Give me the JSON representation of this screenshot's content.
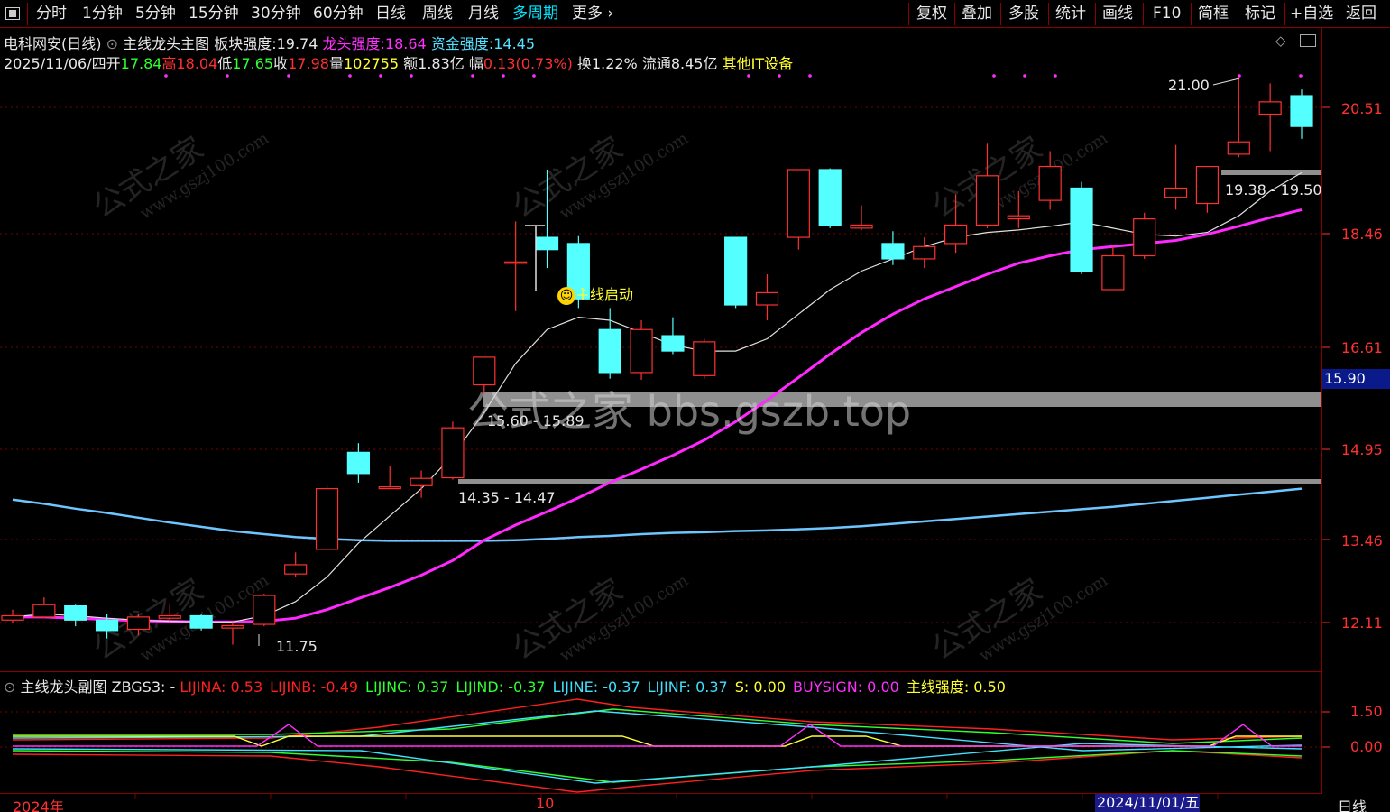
{
  "toolbar": {
    "left": [
      "分时",
      "1分钟",
      "5分钟",
      "15分钟",
      "30分钟",
      "60分钟",
      "日线",
      "周线",
      "月线",
      "多周期",
      "更多"
    ],
    "right": [
      "复权",
      "叠加",
      "多股",
      "统计",
      "画线",
      "F10",
      "简框",
      "标记",
      "+自选",
      "返回"
    ]
  },
  "info": {
    "stock": "电科网安(日线)",
    "indicator": "主线龙头主图",
    "bk_label": "板块强度:",
    "bk_value": "19.74",
    "lt_label": "龙头强度:",
    "lt_value": "18.64",
    "zj_label": "资金强度:",
    "zj_value": "14.45",
    "date": "2025/11/06/四",
    "open_label": "开",
    "open": "17.84",
    "high_label": "高",
    "high": "18.04",
    "low_label": "低",
    "low": "17.65",
    "close_label": "收",
    "close": "17.98",
    "vol_label": "量",
    "vol": "102755",
    "amt_label": "额",
    "amt": "1.83亿",
    "chg_label": "幅",
    "chg": "0.13(0.73%)",
    "turn": "换1.22%",
    "float": "流通8.45亿",
    "sector": "其他IT设备"
  },
  "price_axis": [
    "20.51",
    "18.46",
    "16.61",
    "14.95",
    "13.46",
    "12.11"
  ],
  "current_price_tag": "15.90",
  "annotations": {
    "high_mark": "21.00",
    "low_mark": "11.75",
    "zone1": "15.60 - 15.89",
    "zone2": "14.35 - 14.47",
    "zone3": "19.38 - 19.50",
    "signal": "主线启动"
  },
  "big_watermark": "公式之家 bbs.gszb.top",
  "watermark_text": "公式之家",
  "watermark_url": "www.gszj100.com",
  "sub_info": {
    "name": "主线龙头副图",
    "zbgs": "ZBGS3: -",
    "items": [
      {
        "label": "LIJINA:",
        "value": "0.53",
        "color": "#ff2020"
      },
      {
        "label": "LIJINB:",
        "value": "-0.49",
        "color": "#ff2020"
      },
      {
        "label": "LIJINC:",
        "value": "0.37",
        "color": "#30ff30"
      },
      {
        "label": "LIJIND:",
        "value": "-0.37",
        "color": "#30ff30"
      },
      {
        "label": "LIJINE:",
        "value": "-0.37",
        "color": "#40e0ff"
      },
      {
        "label": "LIJINF:",
        "value": "0.37",
        "color": "#40e0ff"
      },
      {
        "label": "S:",
        "value": "0.00",
        "color": "#ffff30"
      },
      {
        "label": "BUYSIGN:",
        "value": "0.00",
        "color": "#ff30ff"
      },
      {
        "label": "主线强度:",
        "value": "0.50",
        "color": "#ffff30"
      }
    ]
  },
  "sub_axis": [
    "1.50",
    "0.00"
  ],
  "dates": {
    "start": "2024年",
    "mid": "10",
    "hl": "2024/11/01/五",
    "period": "日线"
  },
  "colors": {
    "up": "#ff3030",
    "down": "#54ffff",
    "ma_white": "#e0e0e0",
    "ma_magenta": "#ff28ff",
    "ma_blue": "#6ec6ff"
  },
  "candles": [
    {
      "o": 12.15,
      "c": 12.22,
      "h": 12.32,
      "l": 12.1
    },
    {
      "o": 12.2,
      "c": 12.4,
      "h": 12.52,
      "l": 12.18
    },
    {
      "o": 12.38,
      "c": 12.15,
      "h": 12.4,
      "l": 12.05
    },
    {
      "o": 12.15,
      "c": 11.98,
      "h": 12.25,
      "l": 11.85
    },
    {
      "o": 12.0,
      "c": 12.2,
      "h": 12.25,
      "l": 11.9
    },
    {
      "o": 12.18,
      "c": 12.22,
      "h": 12.4,
      "l": 12.1
    },
    {
      "o": 12.22,
      "c": 12.02,
      "h": 12.25,
      "l": 11.98
    },
    {
      "o": 12.02,
      "c": 12.06,
      "h": 12.12,
      "l": 11.75
    },
    {
      "o": 12.08,
      "c": 12.55,
      "h": 12.58,
      "l": 12.05
    },
    {
      "o": 12.9,
      "c": 13.05,
      "h": 13.25,
      "l": 12.85
    },
    {
      "o": 13.3,
      "c": 14.3,
      "h": 14.35,
      "l": 13.3
    },
    {
      "o": 14.9,
      "c": 14.55,
      "h": 15.05,
      "l": 14.4
    },
    {
      "o": 14.3,
      "c": 14.33,
      "h": 14.68,
      "l": 14.3
    },
    {
      "o": 14.35,
      "c": 14.47,
      "h": 14.6,
      "l": 14.15
    },
    {
      "o": 14.48,
      "c": 15.3,
      "h": 15.4,
      "l": 14.45
    },
    {
      "o": 16.0,
      "c": 16.45,
      "h": 16.45,
      "l": 15.85
    },
    {
      "o": 18.0,
      "c": 18.0,
      "h": 18.66,
      "l": 17.2
    },
    {
      "o": 18.4,
      "c": 18.2,
      "h": 19.5,
      "l": 17.9
    },
    {
      "o": 18.3,
      "c": 17.4,
      "h": 18.42,
      "l": 17.25
    },
    {
      "o": 16.9,
      "c": 16.2,
      "h": 17.25,
      "l": 16.1
    },
    {
      "o": 16.2,
      "c": 16.9,
      "h": 17.05,
      "l": 16.08
    },
    {
      "o": 16.8,
      "c": 16.55,
      "h": 17.1,
      "l": 16.5
    },
    {
      "o": 16.15,
      "c": 16.7,
      "h": 16.75,
      "l": 16.1
    },
    {
      "o": 18.4,
      "c": 17.3,
      "h": 18.4,
      "l": 17.25
    },
    {
      "o": 17.3,
      "c": 17.5,
      "h": 17.8,
      "l": 17.05
    },
    {
      "o": 18.4,
      "c": 19.5,
      "h": 19.5,
      "l": 18.2
    },
    {
      "o": 19.5,
      "c": 18.6,
      "h": 19.52,
      "l": 18.55
    },
    {
      "o": 18.55,
      "c": 18.6,
      "h": 18.92,
      "l": 18.52
    },
    {
      "o": 18.3,
      "c": 18.05,
      "h": 18.5,
      "l": 17.95
    },
    {
      "o": 18.05,
      "c": 18.25,
      "h": 18.4,
      "l": 17.9
    },
    {
      "o": 18.3,
      "c": 18.6,
      "h": 19.1,
      "l": 18.15
    },
    {
      "o": 18.6,
      "c": 19.4,
      "h": 19.92,
      "l": 18.55
    },
    {
      "o": 18.7,
      "c": 18.75,
      "h": 19.15,
      "l": 18.55
    },
    {
      "o": 19.0,
      "c": 19.55,
      "h": 19.8,
      "l": 18.85
    },
    {
      "o": 19.2,
      "c": 17.85,
      "h": 19.3,
      "l": 17.8
    },
    {
      "o": 17.55,
      "c": 18.1,
      "h": 18.25,
      "l": 17.55
    },
    {
      "o": 18.1,
      "c": 18.7,
      "h": 18.8,
      "l": 18.05
    },
    {
      "o": 19.05,
      "c": 19.2,
      "h": 19.9,
      "l": 18.85
    },
    {
      "o": 18.95,
      "c": 19.55,
      "h": 19.55,
      "l": 18.8
    },
    {
      "o": 19.75,
      "c": 19.95,
      "h": 21.0,
      "l": 19.7
    },
    {
      "o": 20.4,
      "c": 20.6,
      "h": 20.9,
      "l": 19.8
    },
    {
      "o": 20.7,
      "c": 20.2,
      "h": 20.8,
      "l": 20.0
    }
  ],
  "ma_white": [
    12.2,
    12.25,
    12.22,
    12.18,
    12.15,
    12.13,
    12.12,
    12.12,
    12.22,
    12.45,
    12.85,
    13.4,
    13.85,
    14.3,
    14.85,
    15.55,
    16.35,
    16.9,
    17.1,
    17.05,
    16.85,
    16.65,
    16.55,
    16.55,
    16.75,
    17.15,
    17.55,
    17.85,
    18.05,
    18.25,
    18.4,
    18.48,
    18.52,
    18.58,
    18.65,
    18.55,
    18.45,
    18.42,
    18.48,
    18.75,
    19.15,
    19.45
  ],
  "ma_magenta": [
    12.2,
    12.2,
    12.18,
    12.16,
    12.14,
    12.13,
    12.12,
    12.12,
    12.13,
    12.18,
    12.32,
    12.5,
    12.68,
    12.88,
    13.12,
    13.45,
    13.7,
    13.92,
    14.15,
    14.4,
    14.62,
    14.85,
    15.1,
    15.4,
    15.75,
    16.12,
    16.5,
    16.85,
    17.15,
    17.4,
    17.6,
    17.8,
    17.98,
    18.1,
    18.2,
    18.25,
    18.3,
    18.35,
    18.45,
    18.58,
    18.72,
    18.85
  ],
  "ma_blue": [
    14.12,
    14.05,
    13.97,
    13.9,
    13.82,
    13.74,
    13.67,
    13.6,
    13.55,
    13.5,
    13.47,
    13.45,
    13.44,
    13.44,
    13.44,
    13.44,
    13.45,
    13.47,
    13.5,
    13.52,
    13.55,
    13.57,
    13.58,
    13.6,
    13.61,
    13.63,
    13.65,
    13.68,
    13.72,
    13.76,
    13.8,
    13.84,
    13.88,
    13.92,
    13.96,
    14.0,
    14.05,
    14.1,
    14.15,
    14.2,
    14.25,
    14.3
  ],
  "chart_data": {
    "type": "candlestick",
    "ylim": [
      11.6,
      21.6
    ],
    "candles_ref": "candles",
    "moving_averages": [
      "ma_white",
      "ma_magenta",
      "ma_blue"
    ]
  }
}
